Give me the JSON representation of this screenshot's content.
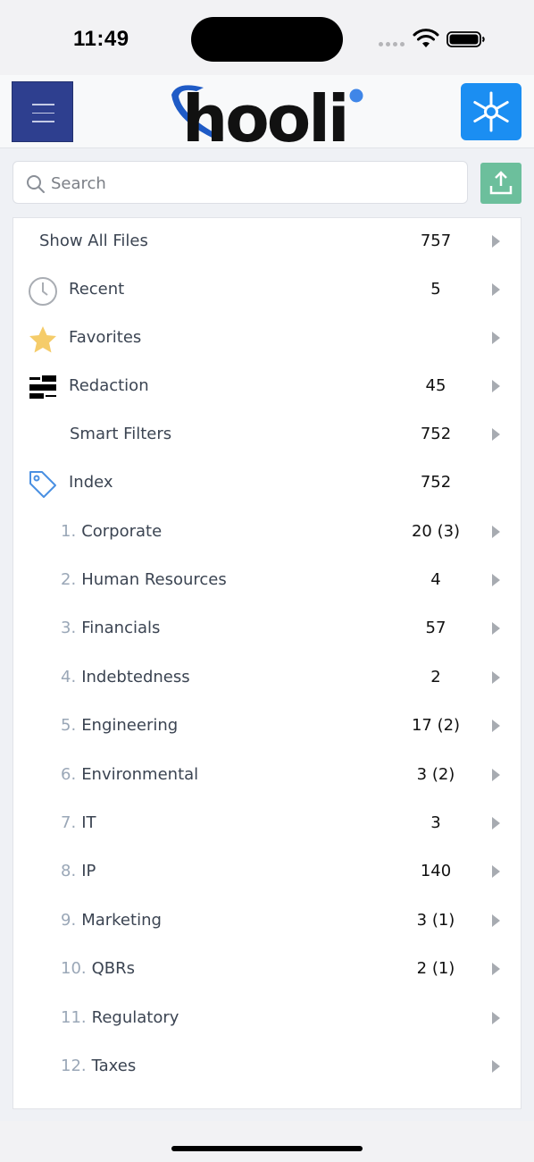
{
  "status_bar": {
    "time": "11:49"
  },
  "header": {
    "logo_text": "hooli"
  },
  "search": {
    "placeholder": "Search"
  },
  "list": [
    {
      "label": "Show All Files",
      "count": "757",
      "icon": "none"
    },
    {
      "label": "Recent",
      "count": "5",
      "icon": "clock-icon"
    },
    {
      "label": "Favorites",
      "count": "",
      "icon": "star-icon"
    },
    {
      "label": "Redaction",
      "count": "45",
      "icon": "redaction-icon"
    },
    {
      "label": "Smart Filters",
      "count": "752",
      "icon": "none"
    },
    {
      "label": "Index",
      "count": "752",
      "icon": "tag-icon"
    }
  ],
  "index_items": [
    {
      "num": "1.",
      "label": "Corporate",
      "count": "20 (3)"
    },
    {
      "num": "2.",
      "label": "Human Resources",
      "count": "4"
    },
    {
      "num": "3.",
      "label": "Financials",
      "count": "57"
    },
    {
      "num": "4.",
      "label": "Indebtedness",
      "count": "2"
    },
    {
      "num": "5.",
      "label": "Engineering",
      "count": "17 (2)"
    },
    {
      "num": "6.",
      "label": "Environmental",
      "count": "3 (2)"
    },
    {
      "num": "7.",
      "label": "IT",
      "count": "3"
    },
    {
      "num": "8.",
      "label": "IP",
      "count": "140"
    },
    {
      "num": "9.",
      "label": "Marketing",
      "count": "3 (1)"
    },
    {
      "num": "10.",
      "label": "QBRs",
      "count": "2 (1)"
    },
    {
      "num": "11.",
      "label": "Regulatory",
      "count": ""
    },
    {
      "num": "12.",
      "label": "Taxes",
      "count": ""
    }
  ],
  "colors": {
    "menu_button": "#2e3f8f",
    "settings_button": "#1b8ef2",
    "upload_button": "#6cbf9c",
    "star": "#f5cc6a",
    "tag": "#4a90e2"
  }
}
